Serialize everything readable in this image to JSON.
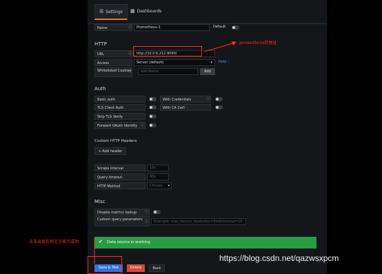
{
  "tabs": {
    "settings": "Settings",
    "dashboards": "Dashboards"
  },
  "name": {
    "label": "Name",
    "value": "Prometheus-1",
    "default_label": "Default"
  },
  "http": {
    "title": "HTTP",
    "url_label": "URL",
    "url_value": "http://10.0.6.212:9090/",
    "access_label": "Access",
    "access_value": "Server (default)",
    "help_label": "Help ›",
    "whitelisted_label": "Whitelisted Cookies",
    "cookie_placeholder": "Add Name",
    "add_label": "Add"
  },
  "auth": {
    "title": "Auth",
    "basic": "Basic auth",
    "tls_client": "TLS Client Auth",
    "skip_tls": "Skip TLS Verify",
    "forward_oauth": "Forward OAuth Identity",
    "with_credentials": "With Credentials",
    "with_ca": "With CA Cert"
  },
  "custom_headers": {
    "title": "Custom HTTP Headers",
    "add_label": "+ Add header"
  },
  "prom": {
    "scrape_label": "Scrape interval",
    "scrape_ph": "15s",
    "timeout_label": "Query timeout",
    "timeout_ph": "60s",
    "method_label": "HTTP Method",
    "method_ph": "Choose"
  },
  "misc": {
    "title": "Misc",
    "disable_lookup": "Disable metrics lookup",
    "custom_query": "Custom query parameters",
    "custom_query_ph": "Example: max_source_resolution=5m&timeout=10"
  },
  "alert": {
    "text": "Data source is working"
  },
  "footer": {
    "save": "Save & Test",
    "delete": "Delete",
    "back": "Back"
  },
  "annotations": {
    "prometheus_addr": "prometheus的地址",
    "click_note": "点击出现右侧文字表示成功"
  },
  "watermark": "https://blog.csdn.net/qazwsxpcm",
  "colors": {
    "alert_green": "#299c46",
    "save_blue": "#3274d9",
    "delete_red": "#d44a3a",
    "annotation_red": "#ff2a2a",
    "tab_accent": "#eb7b18"
  }
}
